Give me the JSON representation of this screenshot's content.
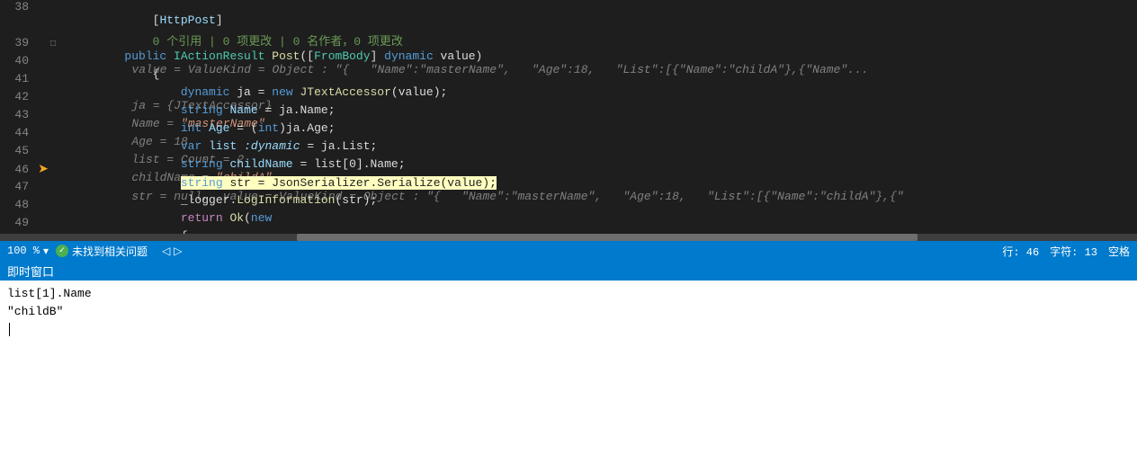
{
  "editor": {
    "lines": [
      {
        "number": "38",
        "indicator": "",
        "collapse": "",
        "code": "    [HttpPost]",
        "hint": "",
        "highlighted": false
      },
      {
        "number": "",
        "indicator": "",
        "collapse": "",
        "code": "    0 个引用 | 0 项更改 | 0 名作者，0 项更改",
        "hint": "",
        "highlighted": false,
        "isRef": true
      },
      {
        "number": "39",
        "indicator": "",
        "collapse": "□",
        "code": "    public IActionResult Post([FromBody] dynamic value)",
        "hint": "value = ValueKind = Object : \"{   \"Name\":\"masterName\",   \"Age\":18,   \"List\":[{\"Name\":\"childA\"},{\"Name\"...",
        "highlighted": false
      },
      {
        "number": "40",
        "indicator": "",
        "collapse": "",
        "code": "    {",
        "hint": "",
        "highlighted": false
      },
      {
        "number": "41",
        "indicator": "",
        "collapse": "",
        "code": "        dynamic ja = new JTextAccessor(value);",
        "hint": "ja = {JTextAccessor}",
        "highlighted": false
      },
      {
        "number": "42",
        "indicator": "",
        "collapse": "",
        "code": "        string Name = ja.Name;",
        "hint": "Name = \"masterName\"",
        "highlighted": false
      },
      {
        "number": "43",
        "indicator": "",
        "collapse": "",
        "code": "        int Age = (int)ja.Age;",
        "hint": "Age = 18",
        "highlighted": false
      },
      {
        "number": "44",
        "indicator": "",
        "collapse": "",
        "code": "        var list :dynamic = ja.List;",
        "hint": "list = Count = 2",
        "highlighted": false
      },
      {
        "number": "45",
        "indicator": "",
        "collapse": "",
        "code": "        string childName = list[0].Name;",
        "hint": "childName = \"childA\"",
        "highlighted": false
      },
      {
        "number": "46",
        "indicator": "arrow",
        "collapse": "",
        "code": "        string str = JsonSerializer.Serialize(value);",
        "hint": "str = null,  value = ValueKind = Object : \"{   \"Name\":\"masterName\",   \"Age\":18,   \"List\":[{\"Name\":\"childA\"},{\"",
        "highlighted": true
      },
      {
        "number": "47",
        "indicator": "",
        "collapse": "",
        "code": "        _logger.LogInformation(str);",
        "hint": "",
        "highlighted": false
      },
      {
        "number": "48",
        "indicator": "",
        "collapse": "",
        "code": "        return Ok(new",
        "hint": "",
        "highlighted": false
      },
      {
        "number": "49",
        "indicator": "",
        "collapse": "",
        "code": "        {",
        "hint": "",
        "highlighted": false
      }
    ]
  },
  "status_bar": {
    "zoom_label": "100 %",
    "zoom_arrow": "▾",
    "status_ok": "未找到相关问题",
    "nav_back": "◁",
    "nav_forward": "▷",
    "line_label": "行: 46",
    "char_label": "字符: 13",
    "encoding": "空格"
  },
  "immediate_window": {
    "title": "即时窗口",
    "lines": [
      "list[1].Name",
      "\"childB\""
    ]
  }
}
